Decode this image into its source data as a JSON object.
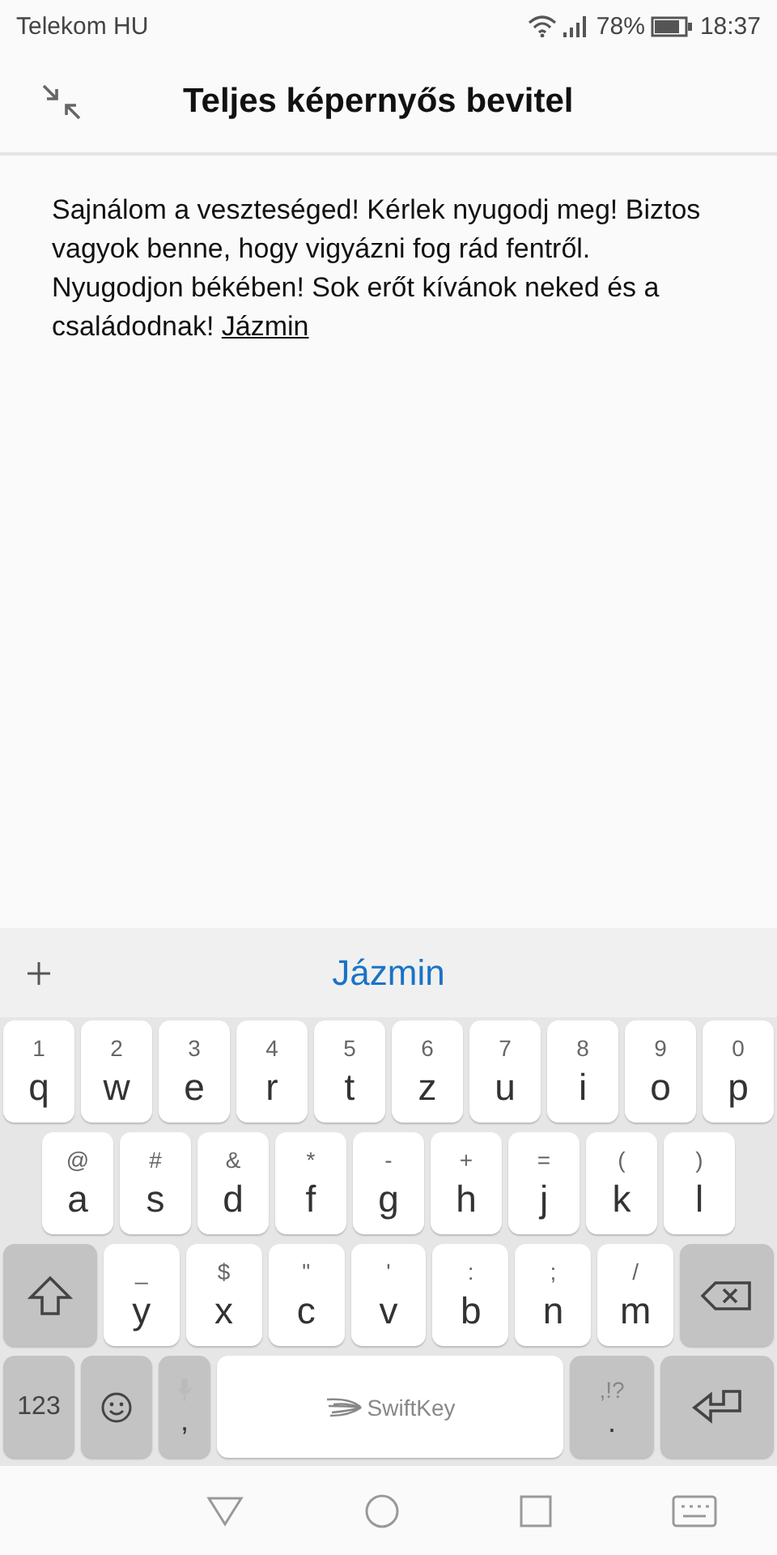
{
  "status_bar": {
    "carrier": "Telekom HU",
    "battery": "78%",
    "time": "18:37"
  },
  "header": {
    "title": "Teljes képernyős bevitel"
  },
  "message": {
    "text": "Sajnálom a veszteséged! Kérlek nyugodj meg! Biztos vagyok benne, hogy vigyázni fog rád fentről. Nyugodjon békében! Sok erőt kívánok neked és a családodnak!",
    "link": "Jázmin"
  },
  "suggestion_bar": {
    "suggestion": "Jázmin"
  },
  "keyboard": {
    "rows": [
      {
        "keys": [
          {
            "kind": "letter",
            "main": "q",
            "alt": "1"
          },
          {
            "kind": "letter",
            "main": "w",
            "alt": "2"
          },
          {
            "kind": "letter",
            "main": "e",
            "alt": "3"
          },
          {
            "kind": "letter",
            "main": "r",
            "alt": "4"
          },
          {
            "kind": "letter",
            "main": "t",
            "alt": "5"
          },
          {
            "kind": "letter",
            "main": "z",
            "alt": "6"
          },
          {
            "kind": "letter",
            "main": "u",
            "alt": "7"
          },
          {
            "kind": "letter",
            "main": "i",
            "alt": "8"
          },
          {
            "kind": "letter",
            "main": "o",
            "alt": "9"
          },
          {
            "kind": "letter",
            "main": "p",
            "alt": "0"
          }
        ]
      },
      {
        "keys": [
          {
            "kind": "letter",
            "main": "a",
            "alt": "@"
          },
          {
            "kind": "letter",
            "main": "s",
            "alt": "#"
          },
          {
            "kind": "letter",
            "main": "d",
            "alt": "&"
          },
          {
            "kind": "letter",
            "main": "f",
            "alt": "*"
          },
          {
            "kind": "letter",
            "main": "g",
            "alt": "-"
          },
          {
            "kind": "letter",
            "main": "h",
            "alt": "+"
          },
          {
            "kind": "letter",
            "main": "j",
            "alt": "="
          },
          {
            "kind": "letter",
            "main": "k",
            "alt": "("
          },
          {
            "kind": "letter",
            "main": "l",
            "alt": ")"
          }
        ]
      },
      {
        "keys": [
          {
            "kind": "shift"
          },
          {
            "kind": "letter",
            "main": "y",
            "alt": "_"
          },
          {
            "kind": "letter",
            "main": "x",
            "alt": "$"
          },
          {
            "kind": "letter",
            "main": "c",
            "alt": "\""
          },
          {
            "kind": "letter",
            "main": "v",
            "alt": "'"
          },
          {
            "kind": "letter",
            "main": "b",
            "alt": ":"
          },
          {
            "kind": "letter",
            "main": "n",
            "alt": ";"
          },
          {
            "kind": "letter",
            "main": "m",
            "alt": "/"
          },
          {
            "kind": "backspace"
          }
        ]
      },
      {
        "keys": [
          {
            "kind": "symbols",
            "main": "123"
          },
          {
            "kind": "emoji"
          },
          {
            "kind": "comma",
            "main": ","
          },
          {
            "kind": "space",
            "main": "SwiftKey"
          },
          {
            "kind": "period",
            "main": ".",
            "alt": ",!?"
          },
          {
            "kind": "enter"
          }
        ]
      }
    ]
  }
}
